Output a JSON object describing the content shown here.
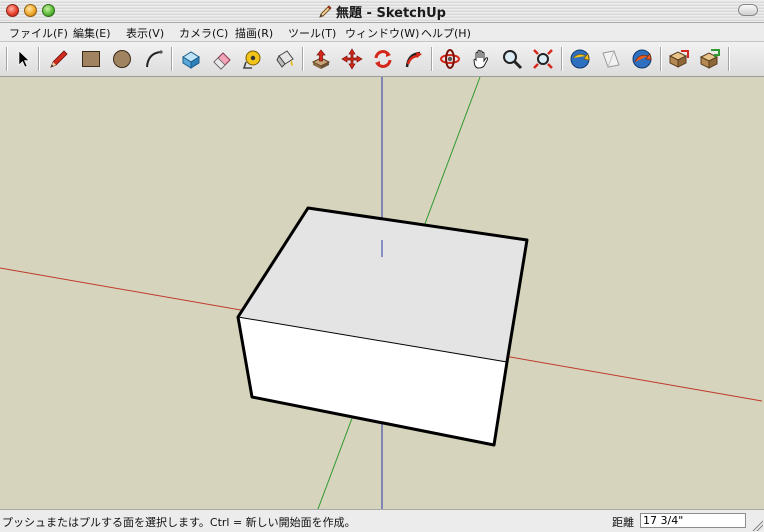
{
  "window": {
    "title": "無題 - SketchUp"
  },
  "menu": {
    "items": [
      {
        "label": "ファイル(F)"
      },
      {
        "label": "編集(E)"
      },
      {
        "label": "表示(V)"
      },
      {
        "label": "カメラ(C)"
      },
      {
        "label": "描画(R)"
      },
      {
        "label": "ツール(T)"
      },
      {
        "label": "ウィンドウ(W)"
      },
      {
        "label": "ヘルプ(H)"
      }
    ]
  },
  "toolbar": {
    "tools": [
      {
        "icon": "select-arrow-icon"
      },
      {
        "icon": "pencil-line-icon"
      },
      {
        "icon": "rectangle-icon"
      },
      {
        "icon": "circle-icon"
      },
      {
        "icon": "arc-icon"
      },
      {
        "icon": "make-component-icon"
      },
      {
        "icon": "eraser-icon"
      },
      {
        "icon": "tape-measure-icon"
      },
      {
        "icon": "paint-bucket-icon"
      },
      {
        "icon": "push-pull-icon"
      },
      {
        "icon": "move-icon"
      },
      {
        "icon": "rotate-icon"
      },
      {
        "icon": "follow-me-icon"
      },
      {
        "icon": "orbit-icon"
      },
      {
        "icon": "pan-hand-icon"
      },
      {
        "icon": "zoom-icon"
      },
      {
        "icon": "zoom-extents-icon"
      },
      {
        "icon": "previous-view-icon"
      },
      {
        "icon": "next-view-icon"
      },
      {
        "icon": "next-view-arrow-icon"
      },
      {
        "icon": "component-browser-icon"
      },
      {
        "icon": "share-model-icon"
      }
    ]
  },
  "viewport": {
    "background_color": "#d6d4bc",
    "axis_colors": {
      "red": "#c0392b",
      "green": "#2f9a2f",
      "blue": "#2a37a8"
    },
    "model": {
      "shape": "box",
      "top_face_color": "#e4e4e4",
      "front_face_color": "#ffffff",
      "edge_color": "#000000"
    }
  },
  "status": {
    "message": "プッシュまたはプルする面を選択します。Ctrl = 新しい開始面を作成。",
    "measurement_label": "距離",
    "measurement_value": "17 3/4\""
  }
}
